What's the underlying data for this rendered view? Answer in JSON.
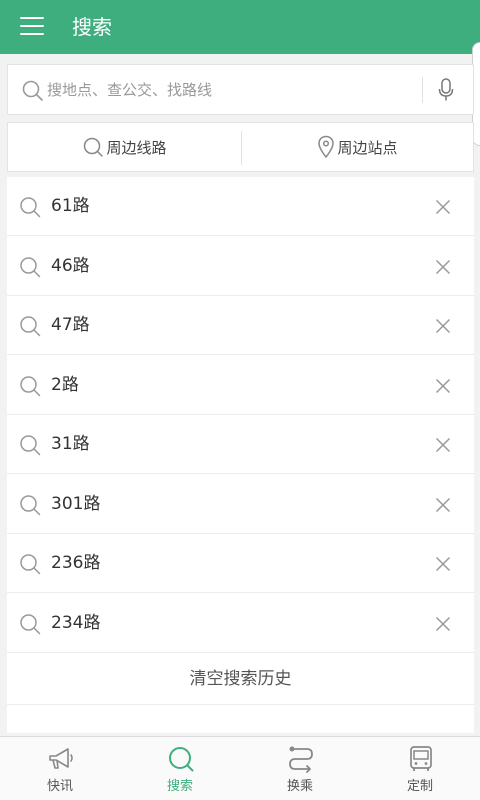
{
  "appbar": {
    "title": "搜索"
  },
  "search": {
    "placeholder": "搜地点、查公交、找路线"
  },
  "nearby": {
    "lines_label": "周边线路",
    "stops_label": "周边站点"
  },
  "history": {
    "items": [
      {
        "label": "61路"
      },
      {
        "label": "46路"
      },
      {
        "label": "47路"
      },
      {
        "label": "2路"
      },
      {
        "label": "31路"
      },
      {
        "label": "301路"
      },
      {
        "label": "236路"
      },
      {
        "label": "234路"
      }
    ],
    "clear_label": "清空搜索历史"
  },
  "tabs": [
    {
      "label": "快讯",
      "icon": "megaphone-icon",
      "active": false
    },
    {
      "label": "搜索",
      "icon": "search-icon",
      "active": true
    },
    {
      "label": "换乘",
      "icon": "transfer-route-icon",
      "active": false
    },
    {
      "label": "定制",
      "icon": "bus-icon",
      "active": false
    }
  ],
  "colors": {
    "accent": "#3fae7f",
    "icon_gray": "#888888"
  }
}
